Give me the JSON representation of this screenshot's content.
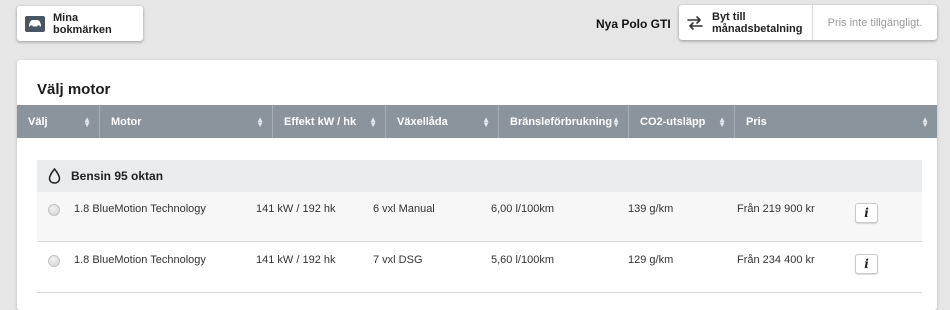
{
  "topbar": {
    "bookmarks_label": "Mina bokmärken",
    "model_name": "Nya Polo GTI",
    "monthly_label": "Byt till månadsbetalning",
    "price_unavailable": "Pris inte tillgängligt."
  },
  "panel": {
    "title": "Välj motor",
    "columns": [
      "Välj",
      "Motor",
      "Effekt kW / hk",
      "Växellåda",
      "Bränsleförbrukning",
      "CO2-utsläpp",
      "Pris"
    ],
    "group_label": "Bensin 95 oktan",
    "rows": [
      {
        "motor": "1.8 BlueMotion Technology",
        "power": "141 kW / 192 hk",
        "gearbox": "6 vxl Manual",
        "consumption": "6,00 l/100km",
        "co2": "139 g/km",
        "price": "Från 219 900 kr",
        "info": "i"
      },
      {
        "motor": "1.8 BlueMotion Technology",
        "power": "141 kW / 192 hk",
        "gearbox": "7 vxl DSG",
        "consumption": "5,60 l/100km",
        "co2": "129 g/km",
        "price": "Från 234 400 kr",
        "info": "i"
      }
    ]
  },
  "icons": {
    "bookmarks": "car-icon",
    "monthly": "swap-arrows-icon",
    "sort": "sort-icon",
    "group": "fuel-drop-icon",
    "row_select": "radio-button",
    "info": "info-icon"
  },
  "colors": {
    "background": "#e6e6e6",
    "table_header": "#8b949d",
    "group_background": "#e9ebec",
    "muted_text": "#9a9a9a"
  }
}
